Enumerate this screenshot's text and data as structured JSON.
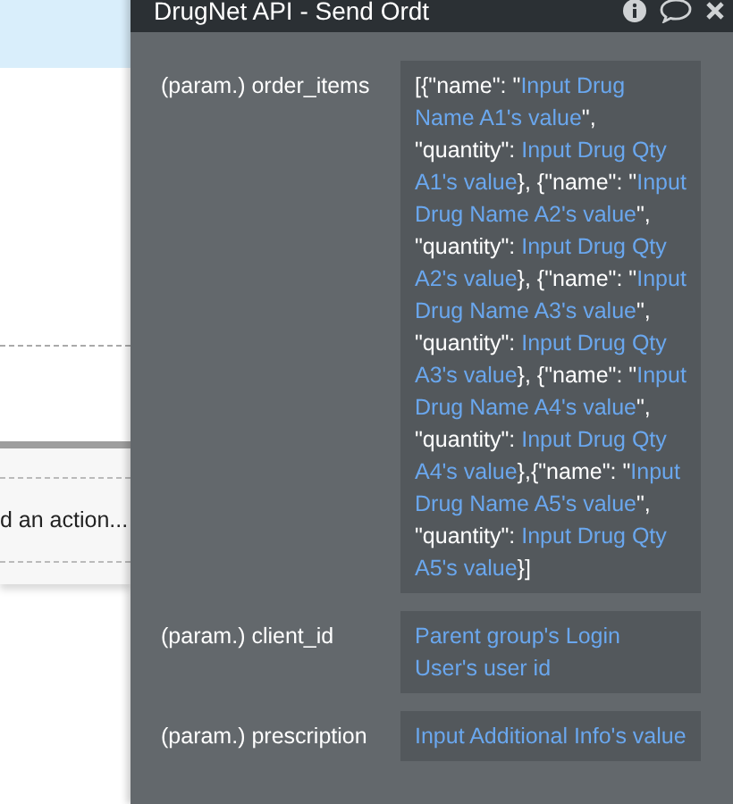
{
  "background": {
    "action_text": "d an action..."
  },
  "panel": {
    "title": "DrugNet API - Send Ordt",
    "params": [
      {
        "label": "(param.) order_items",
        "value": [
          {
            "kind": "literal",
            "text": "[{\"name\": \""
          },
          {
            "kind": "dynamic",
            "text": "Input Drug Name A1's value"
          },
          {
            "kind": "literal",
            "text": "\", \"quantity\": "
          },
          {
            "kind": "dynamic",
            "text": "Input Drug Qty A1's value"
          },
          {
            "kind": "literal",
            "text": "}, {\"name\": \""
          },
          {
            "kind": "dynamic",
            "text": "Input Drug Name A2's value"
          },
          {
            "kind": "literal",
            "text": "\", \"quantity\": "
          },
          {
            "kind": "dynamic",
            "text": "Input Drug Qty A2's value"
          },
          {
            "kind": "literal",
            "text": "}, {\"name\": \""
          },
          {
            "kind": "dynamic",
            "text": "Input Drug Name A3's value"
          },
          {
            "kind": "literal",
            "text": "\", \"quantity\": "
          },
          {
            "kind": "dynamic",
            "text": "Input Drug Qty A3's value"
          },
          {
            "kind": "literal",
            "text": "}, {\"name\": \""
          },
          {
            "kind": "dynamic",
            "text": "Input Drug Name A4's value"
          },
          {
            "kind": "literal",
            "text": "\", \"quantity\": "
          },
          {
            "kind": "dynamic",
            "text": "Input Drug Qty A4's value"
          },
          {
            "kind": "literal",
            "text": "},{\"name\": \""
          },
          {
            "kind": "dynamic",
            "text": "Input Drug Name A5's value"
          },
          {
            "kind": "literal",
            "text": "\", \"quantity\": "
          },
          {
            "kind": "dynamic",
            "text": "Input Drug Qty A5's value"
          },
          {
            "kind": "literal",
            "text": "}]"
          }
        ]
      },
      {
        "label": "(param.) client_id",
        "value": [
          {
            "kind": "dynamic",
            "text": "Parent group's Login User's user id"
          }
        ]
      },
      {
        "label": "(param.) prescription",
        "value": [
          {
            "kind": "dynamic",
            "text": "Input Additional Info's value"
          }
        ]
      }
    ]
  }
}
